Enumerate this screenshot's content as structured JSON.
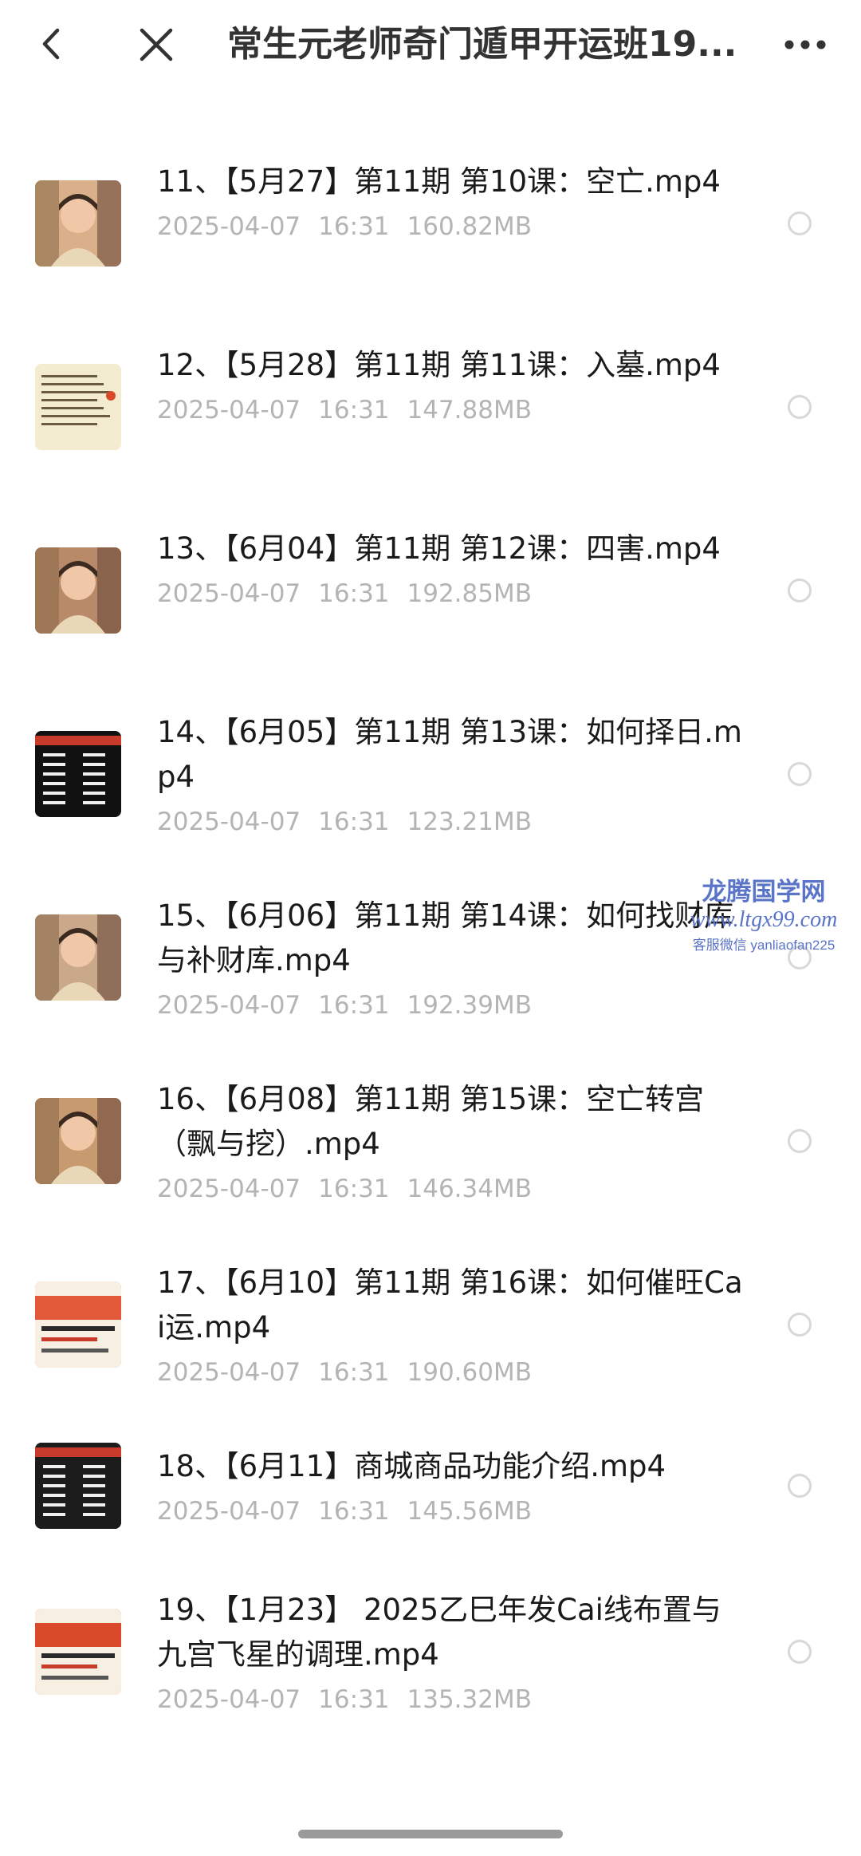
{
  "header": {
    "title": "常生元老师奇门遁甲开运班19...",
    "back_icon": "chevron-left-icon",
    "close_icon": "close-icon",
    "more_icon": "more-dots-icon"
  },
  "files": [
    {
      "name": "11、【5月27】第11期  第10课：空亡.mp4",
      "date": "2025-04-07",
      "time": "16:31",
      "size": "160.82MB",
      "thumb": "teacher-video",
      "thumb_color": "#d9b08a"
    },
    {
      "name": "12、【5月28】第11期  第11课：入墓.mp4",
      "date": "2025-04-07",
      "time": "16:31",
      "size": "147.88MB",
      "thumb": "text-slide",
      "thumb_color": "#f3ecd0"
    },
    {
      "name": "13、【6月04】第11期  第12课：四害.mp4",
      "date": "2025-04-07",
      "time": "16:31",
      "size": "192.85MB",
      "thumb": "teacher-video",
      "thumb_color": "#b88a6a"
    },
    {
      "name": "14、【6月05】第11期  第13课：如何择日.mp4",
      "date": "2025-04-07",
      "time": "16:31",
      "size": "123.21MB",
      "thumb": "dark-slide",
      "thumb_color": "#111111"
    },
    {
      "name": "15、【6月06】第11期  第14课：如何找财库与补财库.mp4",
      "date": "2025-04-07",
      "time": "16:31",
      "size": "192.39MB",
      "thumb": "teacher-video",
      "thumb_color": "#c9a98a"
    },
    {
      "name": "16、【6月08】第11期  第15课：空亡转宫（飘与挖）.mp4",
      "date": "2025-04-07",
      "time": "16:31",
      "size": "146.34MB",
      "thumb": "teacher-video",
      "thumb_color": "#c79a70"
    },
    {
      "name": "17、【6月10】第11期  第16课：如何催旺Cai运.mp4",
      "date": "2025-04-07",
      "time": "16:31",
      "size": "190.60MB",
      "thumb": "poster-slide",
      "thumb_color": "#e25a3a"
    },
    {
      "name": "18、【6月11】商城商品功能介绍.mp4",
      "date": "2025-04-07",
      "time": "16:31",
      "size": "145.56MB",
      "thumb": "dark-slide",
      "thumb_color": "#1c1c1c"
    },
    {
      "name": "19、【1月23】 2025乙巳年发Cai线布置与九宫飞星的调理.mp4",
      "date": "2025-04-07",
      "time": "16:31",
      "size": "135.32MB",
      "thumb": "poster-slide",
      "thumb_color": "#d84a2a"
    }
  ],
  "watermark": {
    "line1": "龙腾国学网",
    "line2": "www.ltgx99.com",
    "line3": "客服微信 yanliaofan225"
  },
  "colors": {
    "meta_text": "#b4b4b4",
    "watermark": "#5a74c8"
  }
}
